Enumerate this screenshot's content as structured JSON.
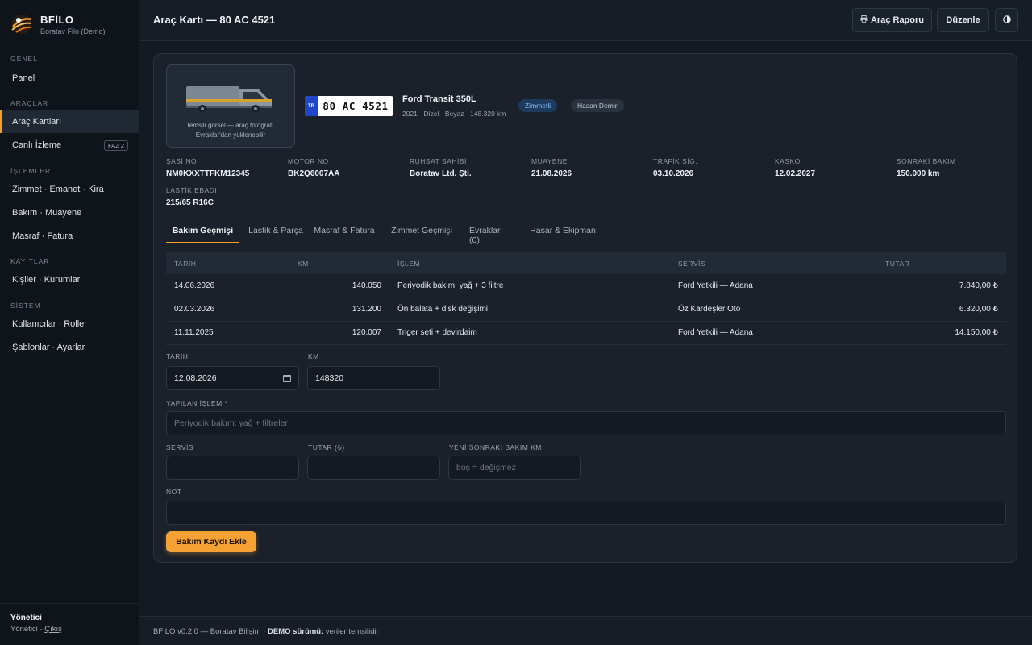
{
  "brand": {
    "name": "BFİLO",
    "subtitle": "Boratav Filo (Demo)"
  },
  "sidebar": {
    "sections": {
      "genel": "GENEL",
      "araclar": "ARAÇLAR",
      "islemler": "İŞLEMLER",
      "kayitlar": "KAYITLAR",
      "sistem": "SİSTEM"
    },
    "items": {
      "panel": "Panel",
      "arac_kartlari": "Araç Kartları",
      "canli_izleme": "Canlı İzleme",
      "canli_izleme_badge": "FAZ 2",
      "zimmet": "Zimmet · Emanet · Kira",
      "bakim": "Bakım · Muayene",
      "masraf": "Masraf · Fatura",
      "kisiler": "Kişiler · Kurumlar",
      "kullanicilar": "Kullanıcılar · Roller",
      "sablonlar": "Şablonlar · Ayarlar"
    },
    "user": {
      "name": "Yönetici",
      "role": "Yönetici",
      "logout": "Çıkış"
    }
  },
  "header": {
    "title": "Araç Kartı — 80 AC 4521",
    "report_button": "Araç Raporu",
    "report_icon": "printer-icon",
    "edit_button": "Düzenle",
    "theme_icon": "contrast-icon"
  },
  "vehicle": {
    "photo_caption_1": "temsilî görsel — araç fotoğrafı",
    "photo_caption_2": "Evraklar'dan yüklenebilir",
    "plate_country": "TR",
    "plate": "80 AC 4521",
    "name": "Ford Transit 350L",
    "subtitle": "2021 · Dizel · Beyaz · 148.320 km",
    "status_badge": "Zimmetli",
    "assignee_badge": "Hasan Demir",
    "colors": {
      "accent": "#f59e2b",
      "status_blue": "#8cc2ff"
    }
  },
  "specs": [
    {
      "label": "ŞASİ NO",
      "value": "NM0KXXTTFKM12345"
    },
    {
      "label": "MOTOR NO",
      "value": "BK2Q6007AA"
    },
    {
      "label": "RUHSAT SAHİBİ",
      "value": "Boratav Ltd. Şti."
    },
    {
      "label": "MUAYENE",
      "value": "21.08.2026"
    },
    {
      "label": "TRAFİK SİG.",
      "value": "03.10.2026"
    },
    {
      "label": "KASKO",
      "value": "12.02.2027"
    },
    {
      "label": "SONRAKİ BAKIM",
      "value": "150.000 km"
    },
    {
      "label": "LASTİK EBADI",
      "value": "215/65 R16C"
    }
  ],
  "tabs": [
    "Bakım Geçmişi",
    "Lastik & Parça",
    "Masraf & Fatura",
    "Zimmet Geçmişi",
    "Evraklar (0)",
    "Hasar & Ekipman"
  ],
  "table": {
    "headers": [
      "TARİH",
      "KM",
      "İŞLEM",
      "SERVİS",
      "TUTAR"
    ],
    "rows": [
      [
        "14.06.2026",
        "140.050",
        "Periyodik bakım: yağ + 3 filtre",
        "Ford Yetkili — Adana",
        "7.840,00 ₺"
      ],
      [
        "02.03.2026",
        "131.200",
        "Ön balata + disk değişimi",
        "Öz Kardeşler Oto",
        "6.320,00 ₺"
      ],
      [
        "11.11.2025",
        "120.007",
        "Triger seti + devirdaim",
        "Ford Yetkili — Adana",
        "14.150,00 ₺"
      ]
    ]
  },
  "form": {
    "date_label": "TARİH",
    "date_value": "12.08.2026",
    "km_label": "KM",
    "km_value": "148320",
    "operation_label": "YAPILAN İŞLEM *",
    "operation_placeholder": "Periyodik bakım: yağ + filtreler",
    "service_label": "SERVİS",
    "amount_label": "TUTAR (₺)",
    "next_km_label": "YENİ SONRAKİ BAKIM KM",
    "next_km_placeholder": "boş = değişmez",
    "note_label": "NOT",
    "submit": "Bakım Kaydı Ekle"
  },
  "footer": {
    "version": "BFİLO v0.2.0 — Boratav Bilişim · ",
    "demo_bold": "DEMO sürümü:",
    "demo_rest": " veriler temsilidir"
  }
}
